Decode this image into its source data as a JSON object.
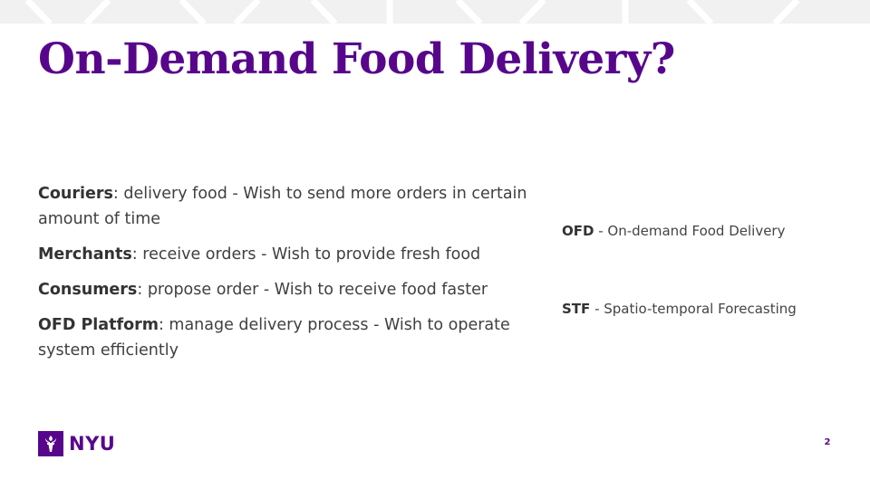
{
  "slide": {
    "title": "On-Demand Food Delivery?",
    "page_number": "2",
    "accent_color": "#57068c"
  },
  "roles": [
    {
      "term": "Couriers",
      "description": ": delivery food - Wish to send more orders in certain amount of time"
    },
    {
      "term": "Merchants",
      "description": ": receive orders - Wish to provide fresh food"
    },
    {
      "term": "Consumers",
      "description": ": propose order - Wish to receive food faster"
    },
    {
      "term": "OFD Platform",
      "description": ": manage delivery process - Wish to operate system efficiently"
    }
  ],
  "abbreviations": [
    {
      "abbr": "OFD",
      "definition": " - On-demand Food Delivery"
    },
    {
      "abbr": "STF",
      "definition": " - Spatio-temporal Forecasting"
    }
  ],
  "logo": {
    "text": "NYU",
    "icon": "torch-icon"
  }
}
